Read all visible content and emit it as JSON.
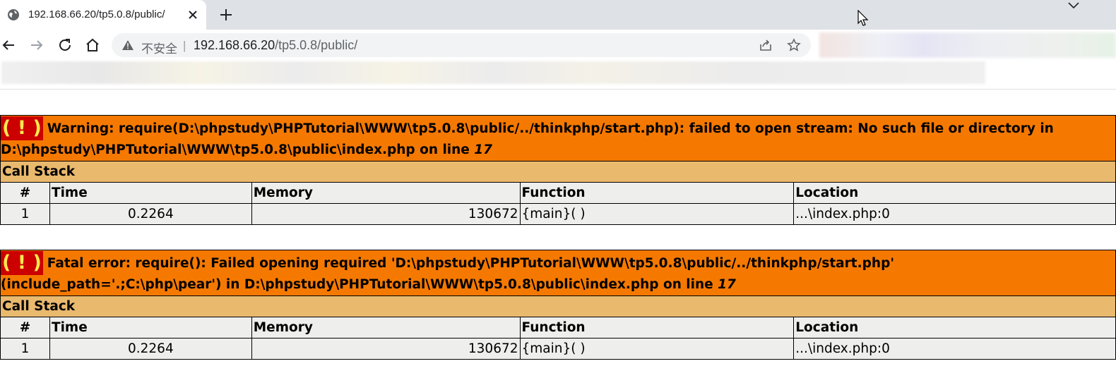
{
  "browser": {
    "tab_title": "192.168.66.20/tp5.0.8/public/",
    "security_label": "不安全",
    "separator": "|",
    "url_host": "192.168.66.20",
    "url_path": "/tp5.0.8/public/"
  },
  "errors": [
    {
      "icon": "( ! )",
      "message": "Warning: require(D:\\phpstudy\\PHPTutorial\\WWW\\tp5.0.8\\public/../thinkphp/start.php): failed to open stream: No such file or directory in D:\\phpstudy\\PHPTutorial\\WWW\\tp5.0.8\\public\\index.php on line ",
      "line": "17",
      "call_stack_label": "Call Stack",
      "columns": [
        "#",
        "Time",
        "Memory",
        "Function",
        "Location"
      ],
      "rows": [
        {
          "num": "1",
          "time": "0.2264",
          "memory": "130672",
          "function": "{main}( )",
          "location": "...\\index.php:0"
        }
      ]
    },
    {
      "icon": "( ! )",
      "message": "Fatal error: require(): Failed opening required 'D:\\phpstudy\\PHPTutorial\\WWW\\tp5.0.8\\public/../thinkphp/start.php' (include_path='.;C:\\php\\pear') in D:\\phpstudy\\PHPTutorial\\WWW\\tp5.0.8\\public\\index.php on line ",
      "line": "17",
      "call_stack_label": "Call Stack",
      "columns": [
        "#",
        "Time",
        "Memory",
        "Function",
        "Location"
      ],
      "rows": [
        {
          "num": "1",
          "time": "0.2264",
          "memory": "130672",
          "function": "{main}( )",
          "location": "...\\index.php:0"
        }
      ]
    }
  ]
}
